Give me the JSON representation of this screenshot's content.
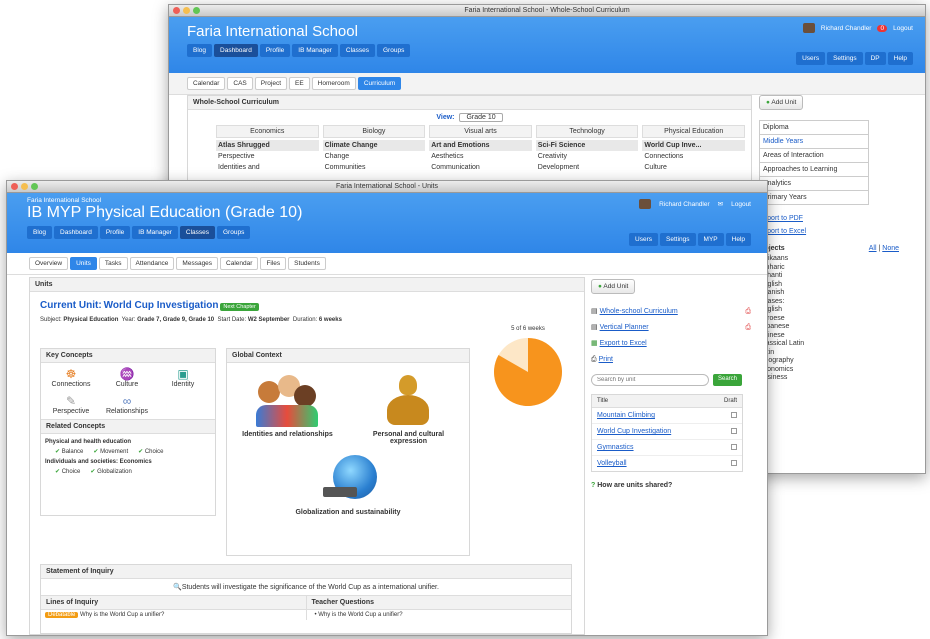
{
  "back": {
    "title": "Faria International School - Whole-School Curriculum",
    "school": "Faria International School",
    "user": "Richard Chandler",
    "badge": "0",
    "logout": "Logout",
    "nav": [
      "Blog",
      "Dashboard",
      "Profile",
      "IB Manager",
      "Classes",
      "Groups"
    ],
    "rnav": [
      "Users",
      "Settings",
      "DP",
      "Help"
    ],
    "tabs": [
      "Calendar",
      "CAS",
      "Project",
      "EE",
      "Homeroom",
      "Curriculum"
    ],
    "panel_title": "Whole-School Curriculum",
    "view_label": "View:",
    "view_value": "Grade 10",
    "subjects": [
      "Economics",
      "Biology",
      "Visual arts",
      "Technology",
      "Physical Education"
    ],
    "units": [
      "Atlas Shrugged",
      "Climate Change",
      "Art and Emotions",
      "Sci-Fi Science",
      "World Cup Inve..."
    ],
    "concepts": [
      [
        "Perspective",
        "Identities and"
      ],
      [
        "Change",
        "Communities"
      ],
      [
        "Aesthetics",
        "Communication"
      ],
      [
        "Creativity",
        "Development"
      ],
      [
        "Connections",
        "Culture"
      ]
    ],
    "add_unit": "Add Unit",
    "side_tabs": [
      "Diploma",
      "Middle Years",
      "Areas of Interaction",
      "Approaches to Learning",
      "Analytics",
      "Primary Years"
    ],
    "exports": [
      "Export to PDF",
      "Export to Excel"
    ],
    "objects_label": "Objects",
    "all": "All",
    "none": "None",
    "languages": [
      "Afrikaans",
      "Amharic",
      "Ashanti",
      "English",
      "Spanish",
      "English",
      "Faroese",
      "Japanese",
      "Chinese",
      "Classical Latin",
      "Latin",
      "Geography",
      "Economics",
      "Business"
    ],
    "phases": "Phases:"
  },
  "front": {
    "title": "Faria International School - Units",
    "school": "Faria International School",
    "page_title": "IB MYP Physical Education (Grade 10)",
    "user": "Richard Chandler",
    "logout": "Logout",
    "nav": [
      "Blog",
      "Dashboard",
      "Profile",
      "IB Manager",
      "Classes",
      "Groups"
    ],
    "rnav": [
      "Users",
      "Settings",
      "MYP",
      "Help"
    ],
    "tabs": [
      "Overview",
      "Units",
      "Tasks",
      "Attendance",
      "Messages",
      "Calendar",
      "Files",
      "Students"
    ],
    "units_heading": "Units",
    "current_unit_label": "Current Unit:",
    "current_unit": "World Cup Investigation",
    "next_chapter": "Next Chapter",
    "meta_subject_label": "Subject:",
    "meta_subject": "Physical Education",
    "meta_year_label": "Year:",
    "meta_year": "Grade 7, Grade 9, Grade 10",
    "meta_start_label": "Start Date:",
    "meta_start": "W2 September",
    "meta_duration_label": "Duration:",
    "meta_duration": "6 weeks",
    "progress_text": "5 of 6 weeks",
    "progress_fraction": 0.833,
    "key_concepts_title": "Key Concepts",
    "key_concepts": [
      "Connections",
      "Culture",
      "Identity",
      "Perspective",
      "Relationships"
    ],
    "related_title": "Related Concepts",
    "related_group1": "Physical and health education",
    "related1": [
      "Balance",
      "Movement",
      "Choice"
    ],
    "related_group2": "Individuals and societies: Economics",
    "related2": [
      "Choice",
      "Globalization"
    ],
    "global_title": "Global Context",
    "global": [
      "Identities and relationships",
      "Personal and cultural expression",
      "Globalization and sustainability"
    ],
    "inquiry_title": "Statement of Inquiry",
    "inquiry_text": "Students will investigate the significance of the World Cup as a international unifier.",
    "lines_title": "Lines of Inquiry",
    "teacher_title": "Teacher Questions",
    "debatable": "Debatable",
    "line1": "Why is the World Cup a unifier?",
    "question1": "Why is the World Cup a unifier?",
    "add_unit": "Add Unit",
    "side_links": [
      "Whole-school Curriculum",
      "Vertical Planner",
      "Export to Excel",
      "Print"
    ],
    "search_placeholder": "Search by unit",
    "search_btn": "Search",
    "table_title": "Title",
    "table_draft": "Draft",
    "unit_list": [
      "Mountain Climbing",
      "World Cup Investigation",
      "Gymnastics",
      "Volleyball"
    ],
    "shared": "How are units shared?"
  },
  "colors": {
    "accent": "#2f86e8",
    "green": "#3aa53a",
    "pie": "#f7941d",
    "pie_bg": "#fde7c7"
  }
}
